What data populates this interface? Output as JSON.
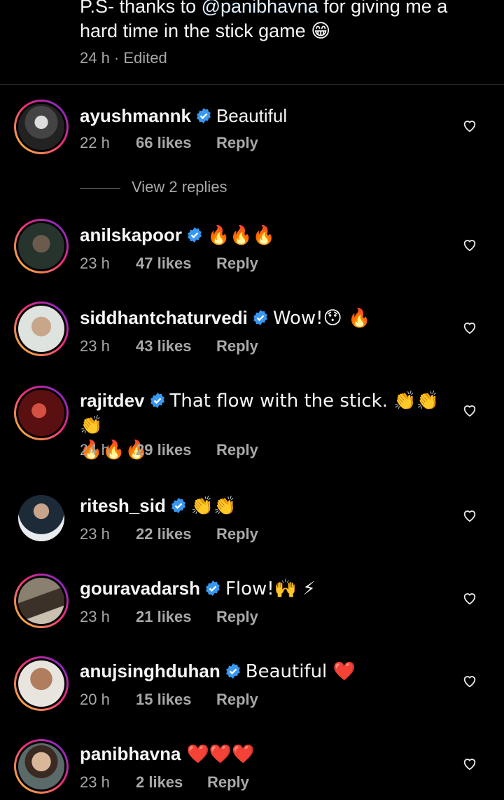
{
  "post": {
    "caption_prefix": "P.S- thanks to ",
    "caption_mention": "@panibhavna",
    "caption_suffix": " for giving me a hard time in the stick game 😁",
    "meta": "24 h · Edited"
  },
  "comments": [
    {
      "username": "ayushmannk",
      "text": "Beautiful",
      "time": "22 h",
      "likes": "66 likes",
      "reply": "Reply",
      "avatar_color": "#555"
    },
    {
      "username": "anilskapoor",
      "text": "🔥🔥🔥",
      "time": "23 h",
      "likes": "47 likes",
      "reply": "Reply",
      "avatar_color": "#3a4a42"
    },
    {
      "username": "siddhantchaturvedi",
      "text": "Wow!😯 🔥",
      "time": "23 h",
      "likes": "43 likes",
      "reply": "Reply",
      "avatar_color": "#b89a80"
    },
    {
      "username": "rajitdev",
      "text": "That flow with the stick. 👏👏👏",
      "text2": "🔥🔥🔥",
      "time": "24 h",
      "likes": "29 likes",
      "reply": "Reply",
      "avatar_color": "#8a1a1a"
    },
    {
      "username": "ritesh_sid",
      "text": "👏👏",
      "time": "23 h",
      "likes": "22 likes",
      "reply": "Reply",
      "avatar_color": "#1e2c3a"
    },
    {
      "username": "gouravadarsh",
      "text": "Flow!🙌 ⚡",
      "time": "23 h",
      "likes": "21 likes",
      "reply": "Reply",
      "avatar_color": "#4a4038"
    },
    {
      "username": "anujsinghduhan",
      "text": "Beautiful ❤️",
      "time": "20 h",
      "likes": "15 likes",
      "reply": "Reply",
      "avatar_color": "#a07a60"
    },
    {
      "username": "panibhavna",
      "text": "❤️❤️❤️",
      "time": "23 h",
      "likes": "2 likes",
      "reply": "Reply",
      "avatar_color": "#c9a98a"
    }
  ],
  "view_replies": "View 2 replies",
  "colors": {
    "verified": "#3897f0",
    "muted": "#a8a8a8"
  },
  "icons": {
    "verified": "verified-badge-icon",
    "like": "heart-outline-icon"
  }
}
